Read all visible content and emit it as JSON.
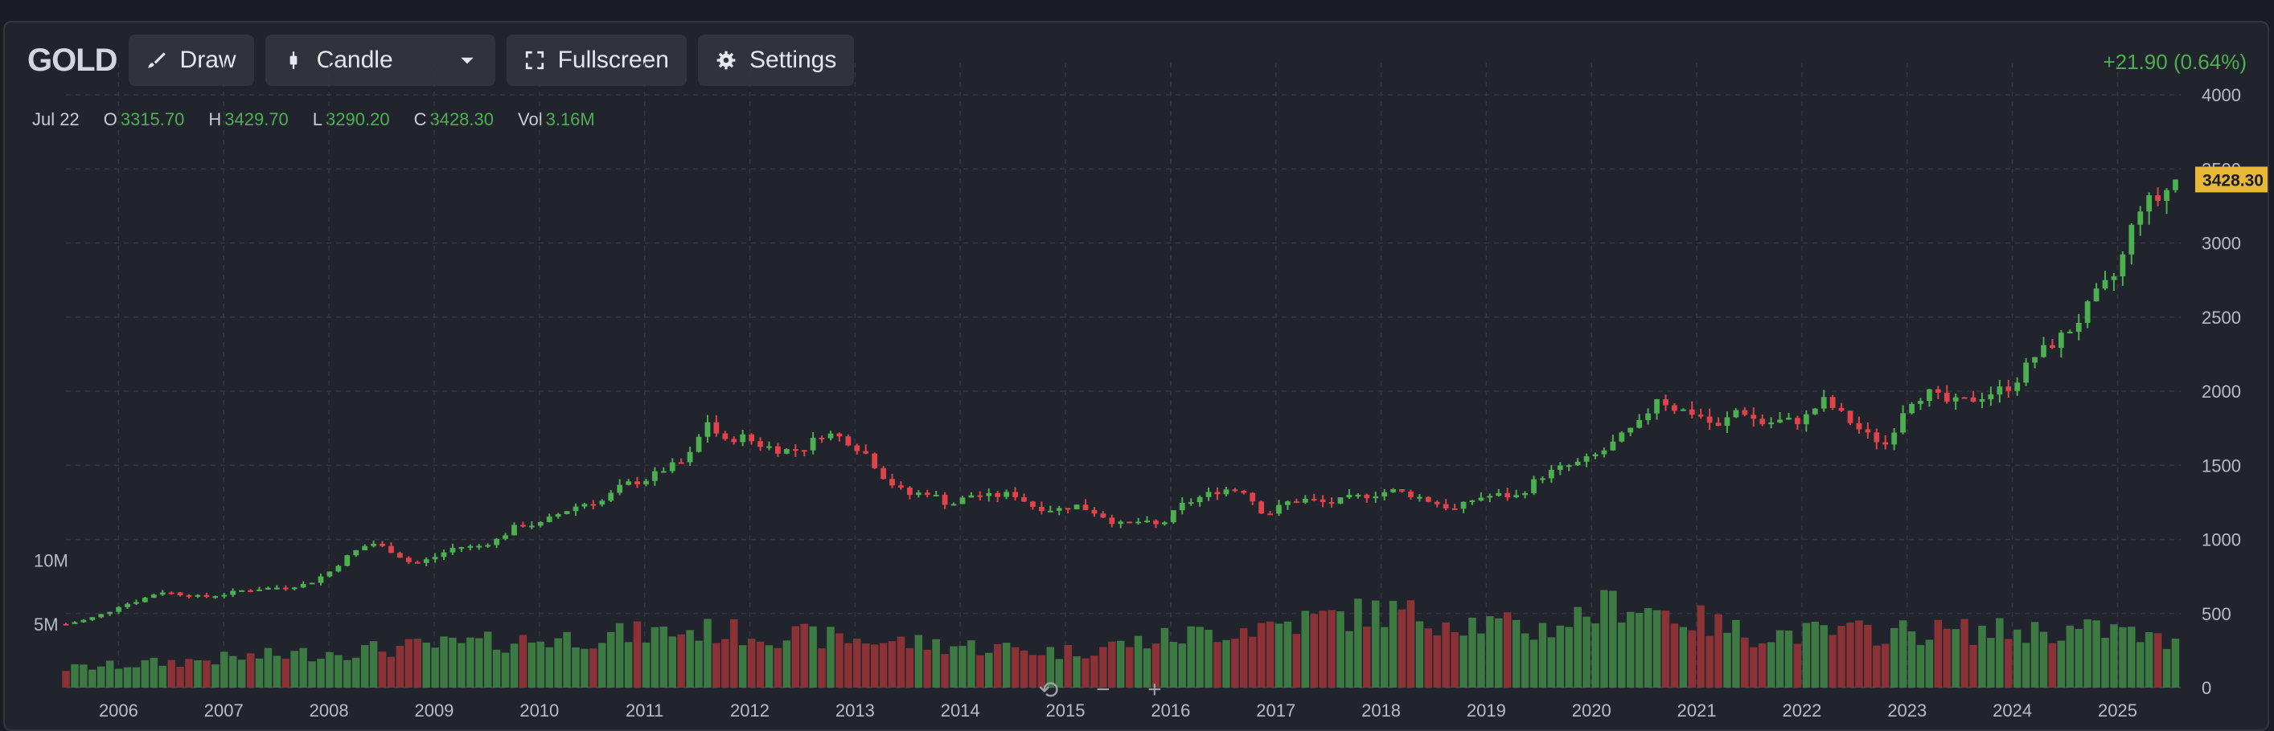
{
  "toolbar": {
    "symbol": "GOLD",
    "draw_label": "Draw",
    "chart_type_label": "Candle",
    "fullscreen_label": "Fullscreen",
    "settings_label": "Settings"
  },
  "change_text": "+21.90 (0.64%)",
  "ohlc": {
    "date": "Jul 22",
    "o_key": "O",
    "o_val": "3315.70",
    "h_key": "H",
    "h_val": "3429.70",
    "l_key": "L",
    "l_val": "3290.20",
    "c_key": "C",
    "c_val": "3428.30",
    "vol_key": "Vol",
    "vol_val": "3.16M"
  },
  "last_price_label": "3428.30",
  "zoom": {
    "reset": "⟲",
    "minus": "−",
    "plus": "+"
  },
  "colors": {
    "up": "#4caf50",
    "down": "#e0444a",
    "vol_up": "#3d7a43",
    "vol_down": "#8a3236",
    "price_tag": "#e8b836"
  },
  "chart_data": {
    "type": "candlestick",
    "price_axis": {
      "ticks": [
        0,
        500,
        1000,
        1500,
        2000,
        2500,
        3000,
        3500,
        4000
      ],
      "ylim": [
        0,
        4000
      ]
    },
    "volume_axis": {
      "ticks": [
        "5M",
        "10M"
      ],
      "tick_values": [
        5,
        10
      ],
      "unit": "M"
    },
    "x_ticks": [
      "2006",
      "2007",
      "2008",
      "2009",
      "2010",
      "2011",
      "2012",
      "2013",
      "2014",
      "2015",
      "2016",
      "2017",
      "2018",
      "2019",
      "2020",
      "2021",
      "2022",
      "2023",
      "2024",
      "2025"
    ],
    "x_range": [
      2005.5,
      2025.6
    ],
    "close_path": [
      [
        2005.5,
        430
      ],
      [
        2005.7,
        460
      ],
      [
        2005.9,
        510
      ],
      [
        2006.0,
        550
      ],
      [
        2006.2,
        590
      ],
      [
        2006.4,
        650
      ],
      [
        2006.6,
        630
      ],
      [
        2006.8,
        610
      ],
      [
        2007.0,
        630
      ],
      [
        2007.2,
        660
      ],
      [
        2007.4,
        670
      ],
      [
        2007.6,
        680
      ],
      [
        2007.8,
        700
      ],
      [
        2008.0,
        780
      ],
      [
        2008.2,
        900
      ],
      [
        2008.4,
        980
      ],
      [
        2008.6,
        920
      ],
      [
        2008.8,
        830
      ],
      [
        2009.0,
        880
      ],
      [
        2009.2,
        950
      ],
      [
        2009.4,
        950
      ],
      [
        2009.6,
        1000
      ],
      [
        2009.8,
        1100
      ],
      [
        2010.0,
        1100
      ],
      [
        2010.2,
        1180
      ],
      [
        2010.4,
        1240
      ],
      [
        2010.6,
        1260
      ],
      [
        2010.8,
        1370
      ],
      [
        2011.0,
        1400
      ],
      [
        2011.2,
        1480
      ],
      [
        2011.4,
        1530
      ],
      [
        2011.6,
        1800
      ],
      [
        2011.75,
        1650
      ],
      [
        2011.9,
        1700
      ],
      [
        2012.1,
        1640
      ],
      [
        2012.3,
        1600
      ],
      [
        2012.5,
        1610
      ],
      [
        2012.7,
        1720
      ],
      [
        2012.9,
        1680
      ],
      [
        2013.1,
        1580
      ],
      [
        2013.3,
        1400
      ],
      [
        2013.5,
        1300
      ],
      [
        2013.7,
        1320
      ],
      [
        2013.9,
        1230
      ],
      [
        2014.1,
        1300
      ],
      [
        2014.3,
        1290
      ],
      [
        2014.5,
        1310
      ],
      [
        2014.7,
        1220
      ],
      [
        2014.9,
        1200
      ],
      [
        2015.1,
        1230
      ],
      [
        2015.3,
        1180
      ],
      [
        2015.5,
        1100
      ],
      [
        2015.7,
        1120
      ],
      [
        2015.9,
        1090
      ],
      [
        2016.1,
        1230
      ],
      [
        2016.3,
        1290
      ],
      [
        2016.5,
        1340
      ],
      [
        2016.7,
        1330
      ],
      [
        2016.9,
        1160
      ],
      [
        2017.1,
        1250
      ],
      [
        2017.3,
        1270
      ],
      [
        2017.5,
        1240
      ],
      [
        2017.7,
        1280
      ],
      [
        2017.9,
        1300
      ],
      [
        2018.1,
        1330
      ],
      [
        2018.3,
        1300
      ],
      [
        2018.5,
        1250
      ],
      [
        2018.7,
        1200
      ],
      [
        2018.9,
        1280
      ],
      [
        2019.1,
        1300
      ],
      [
        2019.3,
        1290
      ],
      [
        2019.5,
        1420
      ],
      [
        2019.7,
        1480
      ],
      [
        2019.9,
        1520
      ],
      [
        2020.1,
        1590
      ],
      [
        2020.3,
        1700
      ],
      [
        2020.5,
        1800
      ],
      [
        2020.6,
        1970
      ],
      [
        2020.8,
        1880
      ],
      [
        2021.0,
        1850
      ],
      [
        2021.2,
        1750
      ],
      [
        2021.4,
        1890
      ],
      [
        2021.6,
        1780
      ],
      [
        2021.8,
        1800
      ],
      [
        2022.0,
        1800
      ],
      [
        2022.2,
        1940
      ],
      [
        2022.4,
        1830
      ],
      [
        2022.6,
        1710
      ],
      [
        2022.8,
        1640
      ],
      [
        2023.0,
        1930
      ],
      [
        2023.2,
        1990
      ],
      [
        2023.4,
        1920
      ],
      [
        2023.6,
        1940
      ],
      [
        2023.8,
        1990
      ],
      [
        2024.0,
        2040
      ],
      [
        2024.2,
        2230
      ],
      [
        2024.4,
        2330
      ],
      [
        2024.6,
        2450
      ],
      [
        2024.8,
        2650
      ],
      [
        2025.0,
        2800
      ],
      [
        2025.2,
        3250
      ],
      [
        2025.4,
        3300
      ],
      [
        2025.55,
        3428
      ]
    ],
    "volume_path": [
      [
        2005.5,
        1.5
      ],
      [
        2008.0,
        2.8
      ],
      [
        2011.5,
        4.5
      ],
      [
        2013.0,
        3.8
      ],
      [
        2015.0,
        2.8
      ],
      [
        2016.5,
        4.5
      ],
      [
        2018.0,
        6.0
      ],
      [
        2019.5,
        4.5
      ],
      [
        2020.3,
        6.8
      ],
      [
        2021.5,
        4.2
      ],
      [
        2023.0,
        4.4
      ],
      [
        2025.0,
        4.5
      ],
      [
        2025.6,
        3.2
      ]
    ],
    "volume_ylim": [
      0,
      12
    ]
  }
}
